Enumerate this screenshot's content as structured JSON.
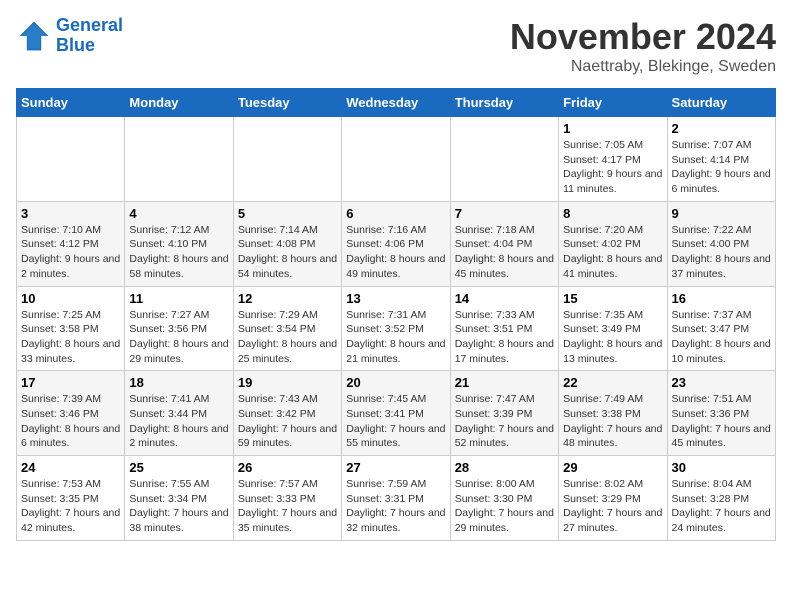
{
  "logo": {
    "line1": "General",
    "line2": "Blue"
  },
  "title": "November 2024",
  "location": "Naettraby, Blekinge, Sweden",
  "days_header": [
    "Sunday",
    "Monday",
    "Tuesday",
    "Wednesday",
    "Thursday",
    "Friday",
    "Saturday"
  ],
  "weeks": [
    [
      {
        "num": "",
        "sunrise": "",
        "sunset": "",
        "daylight": ""
      },
      {
        "num": "",
        "sunrise": "",
        "sunset": "",
        "daylight": ""
      },
      {
        "num": "",
        "sunrise": "",
        "sunset": "",
        "daylight": ""
      },
      {
        "num": "",
        "sunrise": "",
        "sunset": "",
        "daylight": ""
      },
      {
        "num": "",
        "sunrise": "",
        "sunset": "",
        "daylight": ""
      },
      {
        "num": "1",
        "sunrise": "Sunrise: 7:05 AM",
        "sunset": "Sunset: 4:17 PM",
        "daylight": "Daylight: 9 hours and 11 minutes."
      },
      {
        "num": "2",
        "sunrise": "Sunrise: 7:07 AM",
        "sunset": "Sunset: 4:14 PM",
        "daylight": "Daylight: 9 hours and 6 minutes."
      }
    ],
    [
      {
        "num": "3",
        "sunrise": "Sunrise: 7:10 AM",
        "sunset": "Sunset: 4:12 PM",
        "daylight": "Daylight: 9 hours and 2 minutes."
      },
      {
        "num": "4",
        "sunrise": "Sunrise: 7:12 AM",
        "sunset": "Sunset: 4:10 PM",
        "daylight": "Daylight: 8 hours and 58 minutes."
      },
      {
        "num": "5",
        "sunrise": "Sunrise: 7:14 AM",
        "sunset": "Sunset: 4:08 PM",
        "daylight": "Daylight: 8 hours and 54 minutes."
      },
      {
        "num": "6",
        "sunrise": "Sunrise: 7:16 AM",
        "sunset": "Sunset: 4:06 PM",
        "daylight": "Daylight: 8 hours and 49 minutes."
      },
      {
        "num": "7",
        "sunrise": "Sunrise: 7:18 AM",
        "sunset": "Sunset: 4:04 PM",
        "daylight": "Daylight: 8 hours and 45 minutes."
      },
      {
        "num": "8",
        "sunrise": "Sunrise: 7:20 AM",
        "sunset": "Sunset: 4:02 PM",
        "daylight": "Daylight: 8 hours and 41 minutes."
      },
      {
        "num": "9",
        "sunrise": "Sunrise: 7:22 AM",
        "sunset": "Sunset: 4:00 PM",
        "daylight": "Daylight: 8 hours and 37 minutes."
      }
    ],
    [
      {
        "num": "10",
        "sunrise": "Sunrise: 7:25 AM",
        "sunset": "Sunset: 3:58 PM",
        "daylight": "Daylight: 8 hours and 33 minutes."
      },
      {
        "num": "11",
        "sunrise": "Sunrise: 7:27 AM",
        "sunset": "Sunset: 3:56 PM",
        "daylight": "Daylight: 8 hours and 29 minutes."
      },
      {
        "num": "12",
        "sunrise": "Sunrise: 7:29 AM",
        "sunset": "Sunset: 3:54 PM",
        "daylight": "Daylight: 8 hours and 25 minutes."
      },
      {
        "num": "13",
        "sunrise": "Sunrise: 7:31 AM",
        "sunset": "Sunset: 3:52 PM",
        "daylight": "Daylight: 8 hours and 21 minutes."
      },
      {
        "num": "14",
        "sunrise": "Sunrise: 7:33 AM",
        "sunset": "Sunset: 3:51 PM",
        "daylight": "Daylight: 8 hours and 17 minutes."
      },
      {
        "num": "15",
        "sunrise": "Sunrise: 7:35 AM",
        "sunset": "Sunset: 3:49 PM",
        "daylight": "Daylight: 8 hours and 13 minutes."
      },
      {
        "num": "16",
        "sunrise": "Sunrise: 7:37 AM",
        "sunset": "Sunset: 3:47 PM",
        "daylight": "Daylight: 8 hours and 10 minutes."
      }
    ],
    [
      {
        "num": "17",
        "sunrise": "Sunrise: 7:39 AM",
        "sunset": "Sunset: 3:46 PM",
        "daylight": "Daylight: 8 hours and 6 minutes."
      },
      {
        "num": "18",
        "sunrise": "Sunrise: 7:41 AM",
        "sunset": "Sunset: 3:44 PM",
        "daylight": "Daylight: 8 hours and 2 minutes."
      },
      {
        "num": "19",
        "sunrise": "Sunrise: 7:43 AM",
        "sunset": "Sunset: 3:42 PM",
        "daylight": "Daylight: 7 hours and 59 minutes."
      },
      {
        "num": "20",
        "sunrise": "Sunrise: 7:45 AM",
        "sunset": "Sunset: 3:41 PM",
        "daylight": "Daylight: 7 hours and 55 minutes."
      },
      {
        "num": "21",
        "sunrise": "Sunrise: 7:47 AM",
        "sunset": "Sunset: 3:39 PM",
        "daylight": "Daylight: 7 hours and 52 minutes."
      },
      {
        "num": "22",
        "sunrise": "Sunrise: 7:49 AM",
        "sunset": "Sunset: 3:38 PM",
        "daylight": "Daylight: 7 hours and 48 minutes."
      },
      {
        "num": "23",
        "sunrise": "Sunrise: 7:51 AM",
        "sunset": "Sunset: 3:36 PM",
        "daylight": "Daylight: 7 hours and 45 minutes."
      }
    ],
    [
      {
        "num": "24",
        "sunrise": "Sunrise: 7:53 AM",
        "sunset": "Sunset: 3:35 PM",
        "daylight": "Daylight: 7 hours and 42 minutes."
      },
      {
        "num": "25",
        "sunrise": "Sunrise: 7:55 AM",
        "sunset": "Sunset: 3:34 PM",
        "daylight": "Daylight: 7 hours and 38 minutes."
      },
      {
        "num": "26",
        "sunrise": "Sunrise: 7:57 AM",
        "sunset": "Sunset: 3:33 PM",
        "daylight": "Daylight: 7 hours and 35 minutes."
      },
      {
        "num": "27",
        "sunrise": "Sunrise: 7:59 AM",
        "sunset": "Sunset: 3:31 PM",
        "daylight": "Daylight: 7 hours and 32 minutes."
      },
      {
        "num": "28",
        "sunrise": "Sunrise: 8:00 AM",
        "sunset": "Sunset: 3:30 PM",
        "daylight": "Daylight: 7 hours and 29 minutes."
      },
      {
        "num": "29",
        "sunrise": "Sunrise: 8:02 AM",
        "sunset": "Sunset: 3:29 PM",
        "daylight": "Daylight: 7 hours and 27 minutes."
      },
      {
        "num": "30",
        "sunrise": "Sunrise: 8:04 AM",
        "sunset": "Sunset: 3:28 PM",
        "daylight": "Daylight: 7 hours and 24 minutes."
      }
    ]
  ]
}
